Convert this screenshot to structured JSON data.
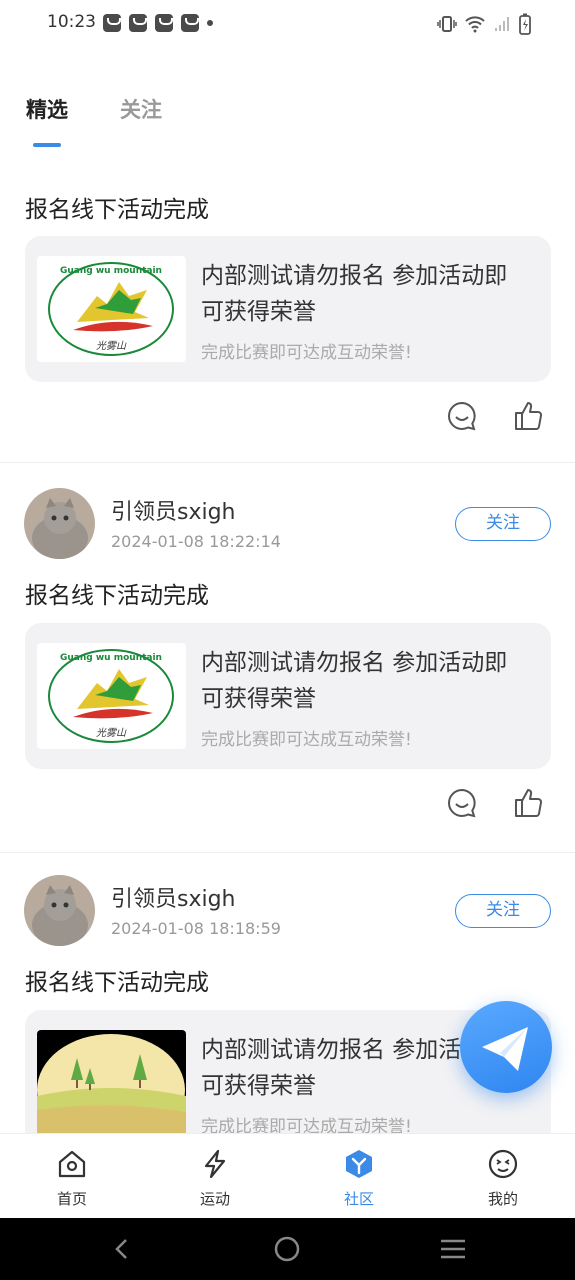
{
  "status_bar": {
    "time": "10:23"
  },
  "tabs": [
    {
      "label": "精选",
      "active": true
    },
    {
      "label": "关注",
      "active": false
    }
  ],
  "posts": [
    {
      "title": "报名线下活动完成",
      "card": {
        "title": "内部测试请勿报名 参加活动即可获得荣誉",
        "subtitle": "完成比赛即可达成互动荣誉!",
        "thumb_text": "Guang wu mountain"
      }
    },
    {
      "author": {
        "name": "引领员sxigh",
        "time": "2024-01-08 18:22:14"
      },
      "follow_label": "关注",
      "title": "报名线下活动完成",
      "card": {
        "title": "内部测试请勿报名 参加活动即可获得荣誉",
        "subtitle": "完成比赛即可达成互动荣誉!",
        "thumb_text": "Guang wu mountain"
      }
    },
    {
      "author": {
        "name": "引领员sxigh",
        "time": "2024-01-08 18:18:59"
      },
      "follow_label": "关注",
      "title": "报名线下活动完成",
      "card": {
        "title": "内部测试请勿报名 参加活动即可获得荣誉",
        "subtitle": "完成比赛即可达成互动荣誉!"
      }
    }
  ],
  "bottom_nav": [
    {
      "label": "首页",
      "icon": "home-icon"
    },
    {
      "label": "运动",
      "icon": "lightning-icon"
    },
    {
      "label": "社区",
      "icon": "community-cube-icon",
      "active": true
    },
    {
      "label": "我的",
      "icon": "smiley-face-icon"
    }
  ],
  "colors": {
    "accent": "#3a8ae6",
    "card_bg": "#f2f2f4",
    "muted": "#999999"
  }
}
